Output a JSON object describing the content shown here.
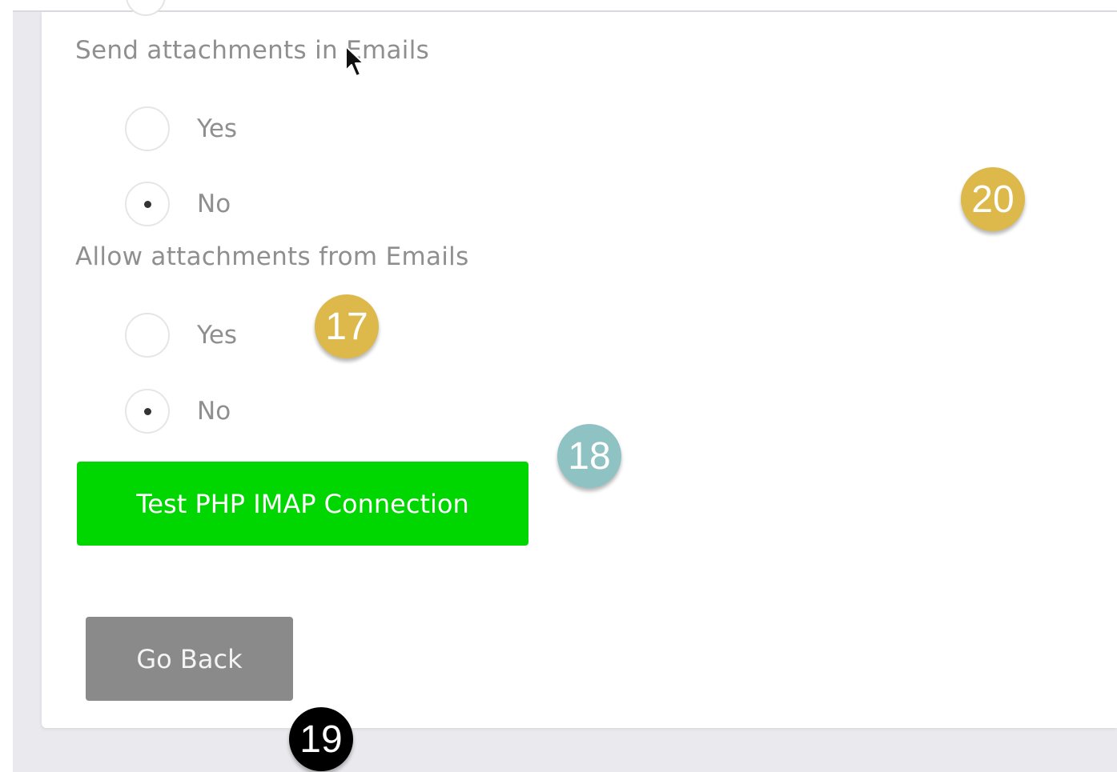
{
  "form": {
    "send_attachments": {
      "question": "Send attachments in Emails",
      "options": [
        {
          "label": "Yes",
          "selected": false
        },
        {
          "label": "No",
          "selected": true
        }
      ]
    },
    "allow_attachments": {
      "question": "Allow attachments from Emails",
      "options": [
        {
          "label": "Yes",
          "selected": false
        },
        {
          "label": "No",
          "selected": true
        }
      ]
    }
  },
  "buttons": {
    "test_imap": "Test PHP IMAP Connection",
    "go_back": "Go Back"
  },
  "badges": [
    {
      "number": "20",
      "color": "#dcb94a"
    },
    {
      "number": "17",
      "color": "#dcb94a"
    },
    {
      "number": "18",
      "color": "#8fc2c2"
    },
    {
      "number": "19",
      "color": "#000000"
    }
  ],
  "colors": {
    "test_button": "#00d600",
    "back_button": "#8a8a8a",
    "text": "#8f8f8f"
  },
  "icons": {
    "cursor": "mouse-pointer-icon"
  }
}
